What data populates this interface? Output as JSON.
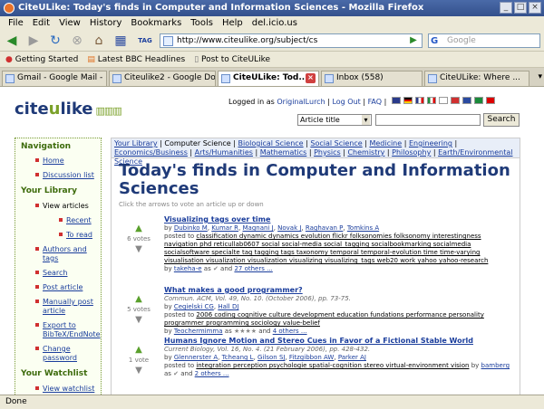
{
  "window": {
    "title": "CiteULike: Today's finds in Computer and Information Sciences - Mozilla Firefox"
  },
  "menu": [
    "File",
    "Edit",
    "View",
    "History",
    "Bookmarks",
    "Tools",
    "Help",
    "del.icio.us"
  ],
  "nav": {
    "url": "http://www.citeulike.org/subject/cs",
    "search_placeholder": "Google",
    "tag_label": "TAG"
  },
  "bookmarks": [
    "Getting Started",
    "Latest BBC Headlines",
    "Post to CiteULike"
  ],
  "tabs": [
    "Gmail - Google Mail - Inb...",
    "Citeulike2 - Google Do...",
    "CiteULike: Tod...",
    "Inbox (558)",
    "CiteULike: Where ..."
  ],
  "page": {
    "logo": {
      "cite": "cite",
      "u": "u",
      "like": "like"
    },
    "login": {
      "prefix": "Logged in as",
      "user": "OriginalLurch",
      "logout": "Log Out",
      "faq": "FAQ"
    },
    "search": {
      "select": "Article title",
      "button": "Search"
    },
    "sidebar": {
      "navigation": "Navigation",
      "home": "Home",
      "discussion": "Discussion list",
      "library": "Your Library",
      "view_articles": "View articles",
      "recent": "Recent",
      "to_read": "To read",
      "authors_tags": "Authors and tags",
      "search": "Search",
      "post": "Post article",
      "manual_post": "Manually post article",
      "export": "Export to BibTeX/EndNote",
      "change_pw": "Change password",
      "watchlist": "Your Watchlist",
      "view_watchlist": "View watchlist"
    },
    "crumbs": {
      "library": "Your Library",
      "current": "Computer Science",
      "items": [
        "Biological Science",
        "Social Science",
        "Medicine",
        "Engineering",
        "Economics/Business",
        "Arts/Humanities",
        "Mathematics",
        "Physics",
        "Chemistry",
        "Philosophy",
        "Earth/Environmental Science"
      ]
    },
    "heading": "Today's finds in Computer and Information Sciences",
    "hint": "Click the arrows to vote an article up or down",
    "articles": [
      {
        "votes": "6 votes",
        "title": "Visualizing tags over time",
        "by": "by",
        "authors": [
          "Dubinko M",
          "Kumar R",
          "Magnani J",
          "Novak J",
          "Raghavan P",
          "Tomkins A"
        ],
        "posted_to": "posted to",
        "tags": "classification dynamic dynamics evolution flickr folksonomies folksonomy interestingness navigation phd reticullab0607 social social-media social_tagging socialbookmarking socialmedia socialsoftware specialte tag tagging tags taxonomy temporal temporal-evolution time time-varying visualisation visualization visualization visualizing visualizing_tags web20 work yahoo yahoo-research",
        "by2": "by",
        "poster": "takeha-e",
        "and": "as",
        "others": "27 others ..."
      },
      {
        "votes": "5 votes",
        "title": "What makes a good programmer?",
        "journal": "Commun. ACM, Vol. 49, No. 10. (October 2006), pp. 73-75.",
        "by": "by",
        "authors": [
          "Cegielski CG",
          "Hall DJ"
        ],
        "posted_to": "posted to",
        "tags": "2006 coding cognitive culture development education fundations performance personality programmer programming sociology value-belief",
        "by2": "by",
        "poster": "Teochermimma",
        "and": "as",
        "others": "4 others ..."
      },
      {
        "votes": "1 vote",
        "title": "Humans Ignore Motion and Stereo Cues in Favor of a Fictional Stable World",
        "journal": "Current Biology, Vol. 16, No. 4. (21 February 2006), pp. 428-432.",
        "by": "by",
        "authors": [
          "Glennerster A",
          "Tcheang L",
          "Gilson SJ",
          "Fitzgibbon AW",
          "Parker AJ"
        ],
        "posted_to": "posted to",
        "tags": "integration perception psychologie spatial-cognition stereo virtual-environment vision",
        "by2": "by",
        "poster": "bamberg",
        "and": "as",
        "others": "2 others ..."
      }
    ]
  },
  "status": "Done",
  "colors": {
    "brand": "#1f3a78",
    "accent_green": "#7ba12a",
    "link": "#1a3d9c"
  }
}
